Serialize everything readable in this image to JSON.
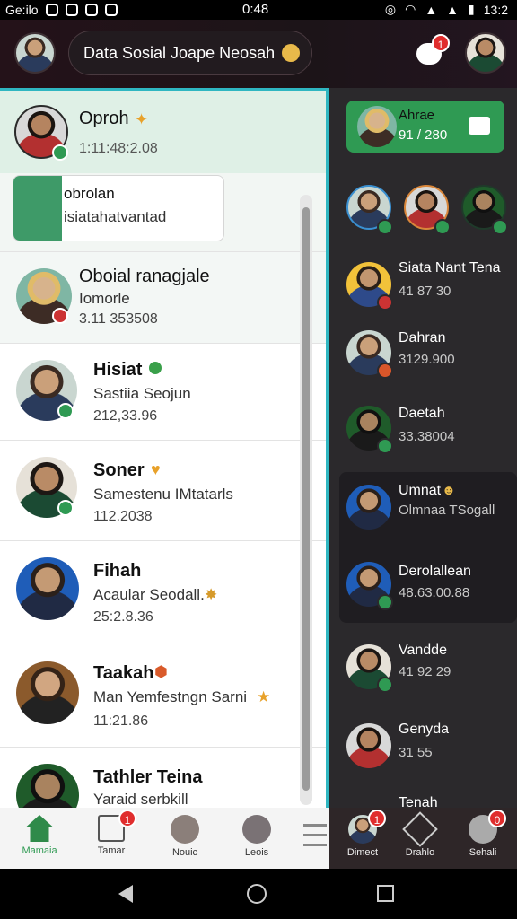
{
  "status_bar": {
    "left_text": "Ge:ilo",
    "center_time": "0:48",
    "right_time": "13:2"
  },
  "header": {
    "title": "Data Sosial Joape Neosah",
    "notif_count": "1"
  },
  "left_panel": {
    "pinned": {
      "name": "Oproh",
      "time": "1:11:48:2.08"
    },
    "note": {
      "title": "obrolan",
      "text": "isiatahatvantad"
    },
    "items": [
      {
        "name": "Oboial ranagjale",
        "sub": "Iomorle",
        "time": "3.11 353508"
      },
      {
        "name": "Hisiat",
        "sub": "Sastiia Seojun",
        "time": "212,33.96"
      },
      {
        "name": "Soner",
        "sub": "Samestenu IMtatarls",
        "time": "112.2038"
      },
      {
        "name": "Fihah",
        "sub": "Acaular Seodall.",
        "time": "25:2.8.36"
      },
      {
        "name": "Taakah",
        "sub": "Man Yemfestngn Sarni",
        "time": "11:21.86"
      },
      {
        "name": "Tathler Teina",
        "sub": "Yaraid serbkill"
      }
    ]
  },
  "right_panel": {
    "featured": {
      "name": "Ahrae",
      "count": "91 / 280"
    },
    "items": [
      {
        "name": "Siata Nant Tena",
        "sub": "41 87 30"
      },
      {
        "name": "Dahran",
        "sub": "3129.900"
      },
      {
        "name": "Daetah",
        "sub": "33.38004"
      },
      {
        "name": "Umnat",
        "sub": "Olmnaa TSogall"
      },
      {
        "name": "Derolallean",
        "sub": "48.63.00.88"
      },
      {
        "name": "Vandde",
        "sub": "41 92 29"
      },
      {
        "name": "Genyda",
        "sub": "31 55"
      },
      {
        "name": "Tenah"
      }
    ]
  },
  "bottom_nav": {
    "items": [
      "Mamaia",
      "Tamar",
      "Nouic",
      "Leois"
    ],
    "right_items": [
      "Dimect",
      "Drahlo",
      "Sehali"
    ],
    "badges": [
      "1",
      "1",
      "0"
    ]
  },
  "colors": {
    "accent": "#2fb6c1",
    "green": "#2f9a53",
    "red": "#e02d2d"
  }
}
